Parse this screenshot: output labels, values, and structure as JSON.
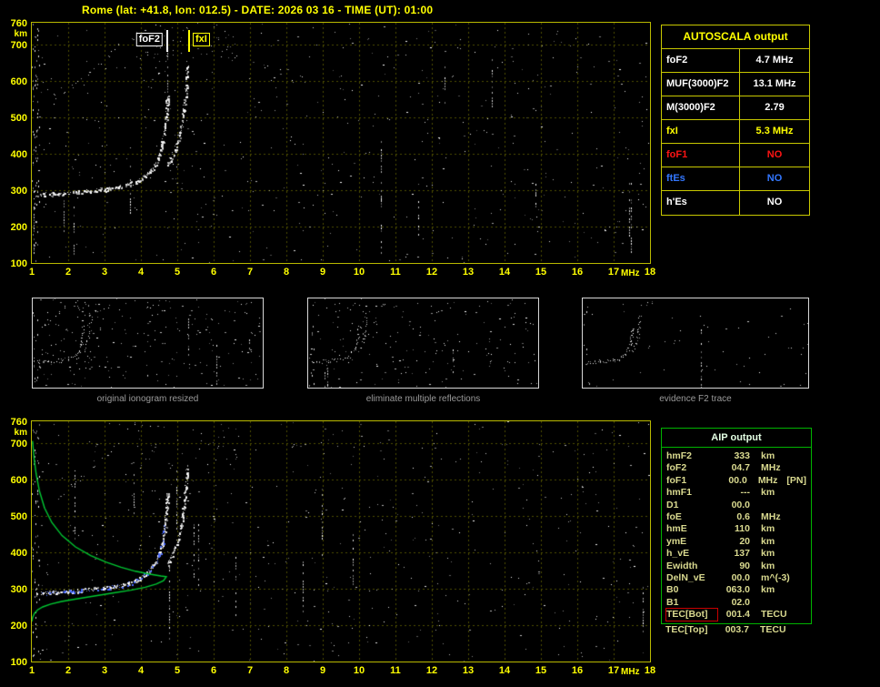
{
  "header": {
    "title": "Rome (lat: +41.8, lon: 012.5) - DATE: 2026 03 16 - TIME (UT): 01:00"
  },
  "autoscala_table": {
    "title": "AUTOSCALA output",
    "rows": [
      {
        "label": "foF2",
        "value": "4.7 MHz",
        "color": "#ffffff"
      },
      {
        "label": "MUF(3000)F2",
        "value": "13.1 MHz",
        "color": "#ffffff"
      },
      {
        "label": "M(3000)F2",
        "value": "2.79",
        "color": "#ffffff"
      },
      {
        "label": "fxI",
        "value": "5.3 MHz",
        "color": "#ffff00"
      },
      {
        "label": "foF1",
        "value": "NO",
        "color": "#ff1414"
      },
      {
        "label": "ftEs",
        "value": "NO",
        "color": "#3377ff"
      },
      {
        "label": "h'Es",
        "value": "NO",
        "color": "#ffffff"
      }
    ]
  },
  "thumbnails": [
    {
      "caption": "original ionogram resized"
    },
    {
      "caption": "eliminate multiple reflections"
    },
    {
      "caption": "evidence F2 trace"
    }
  ],
  "aip_table": {
    "title": "AIP output",
    "rows": [
      {
        "label": "hmF2",
        "value": "333",
        "unit": "km"
      },
      {
        "label": "foF2",
        "value": "04.7",
        "unit": "MHz"
      },
      {
        "label": "foF1",
        "value": "00.0",
        "unit": "MHz",
        "note": "[PN]"
      },
      {
        "label": "hmF1",
        "value": "---",
        "unit": "km"
      },
      {
        "label": "D1",
        "value": "00.0",
        "unit": ""
      },
      {
        "label": "foE",
        "value": "0.6",
        "unit": "MHz"
      },
      {
        "label": "hmE",
        "value": "110",
        "unit": "km"
      },
      {
        "label": "ymE",
        "value": "20",
        "unit": "km"
      },
      {
        "label": "h_vE",
        "value": "137",
        "unit": "km"
      },
      {
        "label": "Ewidth",
        "value": "90",
        "unit": "km"
      },
      {
        "label": "DelN_vE",
        "value": "00.0",
        "unit": "m^(-3)"
      },
      {
        "label": "B0",
        "value": "063.0",
        "unit": "km"
      },
      {
        "label": "B1",
        "value": "02.0",
        "unit": ""
      },
      {
        "label": "TEC[Bot]",
        "value": "001.4",
        "unit": "TECU",
        "highlight": true
      },
      {
        "label": "TEC[Top]",
        "value": "003.7",
        "unit": "TECU"
      }
    ]
  },
  "chart_data": [
    {
      "type": "scatter",
      "name": "ionogram-recorded",
      "title": "Rome ionogram 2026-03-16 01:00 UT",
      "xlabel": "MHz",
      "ylabel": "km",
      "xlim": [
        1,
        18
      ],
      "ylim": [
        100,
        760
      ],
      "x_ticks": [
        1,
        2,
        3,
        4,
        5,
        6,
        7,
        8,
        9,
        10,
        11,
        12,
        13,
        14,
        15,
        16,
        17,
        18
      ],
      "y_ticks": [
        760,
        700,
        600,
        500,
        400,
        300,
        200,
        100
      ],
      "grid": true,
      "markers": [
        {
          "label": "foF2",
          "freq": 4.7,
          "color": "#ffffff"
        },
        {
          "label": "fxI",
          "freq": 5.3,
          "color": "#ffff00"
        }
      ],
      "series": [
        {
          "name": "f2-ordinary-trace",
          "render": "dots",
          "color": "#ffffff",
          "density": 1.3,
          "dot": 2,
          "points": [
            [
              1.15,
              287
            ],
            [
              1.5,
              290
            ],
            [
              2.0,
              294
            ],
            [
              2.5,
              298
            ],
            [
              3.0,
              303
            ],
            [
              3.4,
              309
            ],
            [
              3.7,
              317
            ],
            [
              3.95,
              328
            ],
            [
              4.15,
              342
            ],
            [
              4.3,
              358
            ],
            [
              4.42,
              378
            ],
            [
              4.5,
              398
            ],
            [
              4.57,
              422
            ],
            [
              4.62,
              448
            ],
            [
              4.66,
              478
            ],
            [
              4.69,
              508
            ],
            [
              4.71,
              538
            ],
            [
              4.73,
              562
            ]
          ]
        },
        {
          "name": "f2-extraordinary-trace",
          "render": "dots",
          "color": "#ffffff",
          "density": 1.0,
          "dot": 2,
          "points": [
            [
              4.72,
              368
            ],
            [
              4.82,
              385
            ],
            [
              4.92,
              408
            ],
            [
              5.0,
              432
            ],
            [
              5.07,
              458
            ],
            [
              5.12,
              485
            ],
            [
              5.16,
              512
            ],
            [
              5.2,
              542
            ],
            [
              5.23,
              575
            ],
            [
              5.26,
              612
            ],
            [
              5.28,
              645
            ]
          ]
        },
        {
          "name": "multiple-reflection-trace",
          "render": "dots",
          "color": "#ffffff",
          "density": 0.22,
          "dot": 1,
          "points": [
            [
              1.55,
              538
            ],
            [
              1.75,
              555
            ],
            [
              1.95,
              572
            ],
            [
              2.15,
              588
            ],
            [
              2.35,
              604
            ],
            [
              2.55,
              620
            ],
            [
              2.75,
              637
            ],
            [
              2.95,
              655
            ],
            [
              3.15,
              674
            ],
            [
              3.3,
              694
            ],
            [
              3.4,
              708
            ]
          ]
        }
      ]
    },
    {
      "type": "scatter",
      "name": "ionogram-interpreted",
      "title": "Ionogram with restored trace and electron density profile",
      "xlabel": "MHz",
      "ylabel": "km",
      "xlim": [
        1,
        18
      ],
      "ylim": [
        100,
        760
      ],
      "x_ticks": [
        1,
        2,
        3,
        4,
        5,
        6,
        7,
        8,
        9,
        10,
        11,
        12,
        13,
        14,
        15,
        16,
        17,
        18
      ],
      "y_ticks": [
        760,
        700,
        600,
        500,
        400,
        300,
        200,
        100
      ],
      "grid": true,
      "markers": [],
      "series": [
        {
          "name": "f2-ordinary-trace",
          "render": "dots",
          "color": "#ffffff",
          "density": 1.3,
          "dot": 2,
          "points": [
            [
              1.15,
              287
            ],
            [
              1.5,
              290
            ],
            [
              2.0,
              294
            ],
            [
              2.5,
              298
            ],
            [
              3.0,
              303
            ],
            [
              3.4,
              309
            ],
            [
              3.7,
              317
            ],
            [
              3.95,
              328
            ],
            [
              4.15,
              342
            ],
            [
              4.3,
              358
            ],
            [
              4.42,
              378
            ],
            [
              4.5,
              398
            ],
            [
              4.57,
              422
            ],
            [
              4.62,
              448
            ],
            [
              4.66,
              478
            ],
            [
              4.69,
              508
            ],
            [
              4.71,
              538
            ],
            [
              4.73,
              562
            ]
          ]
        },
        {
          "name": "f2-extraordinary-trace",
          "render": "dots",
          "color": "#ffffff",
          "density": 1.0,
          "dot": 2,
          "points": [
            [
              4.72,
              368
            ],
            [
              4.82,
              385
            ],
            [
              4.92,
              408
            ],
            [
              5.0,
              432
            ],
            [
              5.07,
              458
            ],
            [
              5.12,
              485
            ],
            [
              5.16,
              512
            ],
            [
              5.2,
              542
            ],
            [
              5.23,
              575
            ],
            [
              5.26,
              612
            ],
            [
              5.28,
              645
            ]
          ]
        },
        {
          "name": "multiple-reflection-trace",
          "render": "dots",
          "color": "#ffffff",
          "density": 0.2,
          "dot": 1,
          "points": [
            [
              1.55,
              538
            ],
            [
              1.75,
              555
            ],
            [
              1.95,
              572
            ],
            [
              2.15,
              588
            ],
            [
              2.35,
              604
            ],
            [
              2.55,
              620
            ],
            [
              2.75,
              637
            ],
            [
              2.95,
              655
            ],
            [
              3.15,
              674
            ],
            [
              3.3,
              694
            ],
            [
              3.4,
              708
            ]
          ]
        },
        {
          "name": "restored-trace",
          "render": "dots",
          "color": "#4b6bff",
          "density": 0.38,
          "dot": 2,
          "points": [
            [
              1.2,
              289
            ],
            [
              1.6,
              292
            ],
            [
              2.1,
              296
            ],
            [
              2.6,
              300
            ],
            [
              3.1,
              306
            ],
            [
              3.5,
              313
            ],
            [
              3.8,
              322
            ],
            [
              4.05,
              335
            ],
            [
              4.25,
              352
            ],
            [
              4.4,
              374
            ],
            [
              4.5,
              398
            ],
            [
              4.58,
              428
            ],
            [
              4.63,
              458
            ],
            [
              4.66,
              490
            ]
          ]
        },
        {
          "name": "electron-density-profile",
          "render": "line",
          "color": "#00c832",
          "points": [
            [
              1.02,
              706
            ],
            [
              1.06,
              660
            ],
            [
              1.12,
              615
            ],
            [
              1.21,
              568
            ],
            [
              1.35,
              522
            ],
            [
              1.55,
              482
            ],
            [
              1.83,
              446
            ],
            [
              2.2,
              415
            ],
            [
              2.62,
              391
            ],
            [
              3.05,
              373
            ],
            [
              3.45,
              359
            ],
            [
              3.85,
              348
            ],
            [
              4.25,
              340
            ],
            [
              4.55,
              335
            ],
            [
              4.7,
              333
            ],
            [
              4.62,
              322
            ],
            [
              4.42,
              313
            ],
            [
              4.12,
              304
            ],
            [
              3.72,
              296
            ],
            [
              3.22,
              288
            ],
            [
              2.72,
              280
            ],
            [
              2.22,
              272
            ],
            [
              1.82,
              265
            ],
            [
              1.52,
              258
            ],
            [
              1.3,
              250
            ],
            [
              1.16,
              242
            ],
            [
              1.07,
              232
            ],
            [
              1.02,
              221
            ],
            [
              1.0,
              210
            ]
          ]
        }
      ]
    }
  ]
}
